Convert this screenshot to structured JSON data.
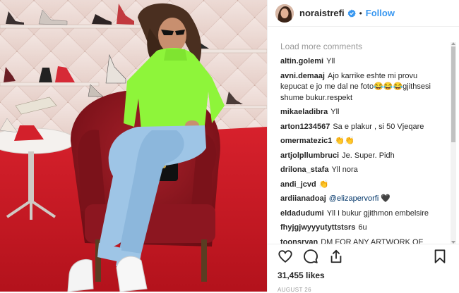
{
  "post": {
    "username": "noraistrefi",
    "dot": "•",
    "follow_label": "Follow"
  },
  "comments_section": {
    "load_more": "Load more comments",
    "items": [
      {
        "user": "altin.golemi",
        "text": "Yll"
      },
      {
        "user": "avni.demaaj",
        "text": "Ajo karrike eshte mi provu kepucat e jo me dal ne foto😂😂😂gjithsesi shume bukur.respekt"
      },
      {
        "user": "mikaeladibra",
        "text": "Yll"
      },
      {
        "user": "arton1234567",
        "text": "Sa e plakur , si 50 Vjeqare"
      },
      {
        "user": "omermatezic1",
        "text": "👏👏"
      },
      {
        "user": "artjolpllumbruci",
        "text": "Je. Super. Pidh"
      },
      {
        "user": "drilona_stafa",
        "text": "Yll nora"
      },
      {
        "user": "andi_jcvd",
        "text": "👏"
      },
      {
        "user": "ardiianadoaj",
        "mention": "@elizapervorfi",
        "text": "🖤"
      },
      {
        "user": "eldadudumi",
        "text": "Yll I bukur gjithmon embelsire"
      },
      {
        "user": "fhyjgjwyyyutyttstsrs",
        "text": "6u"
      },
      {
        "user": "toonsryan",
        "text": "DM FOR ANY ARTWORK OF"
      }
    ]
  },
  "footer": {
    "likes": "31,455 likes",
    "date": "AUGUST 26"
  },
  "icons": {
    "like": "heart-icon",
    "comment": "comment-icon",
    "share": "share-icon",
    "save": "bookmark-icon",
    "verified": "verified-badge-icon"
  },
  "colors": {
    "accent": "#3897f0",
    "text": "#262626",
    "muted": "#999999"
  }
}
